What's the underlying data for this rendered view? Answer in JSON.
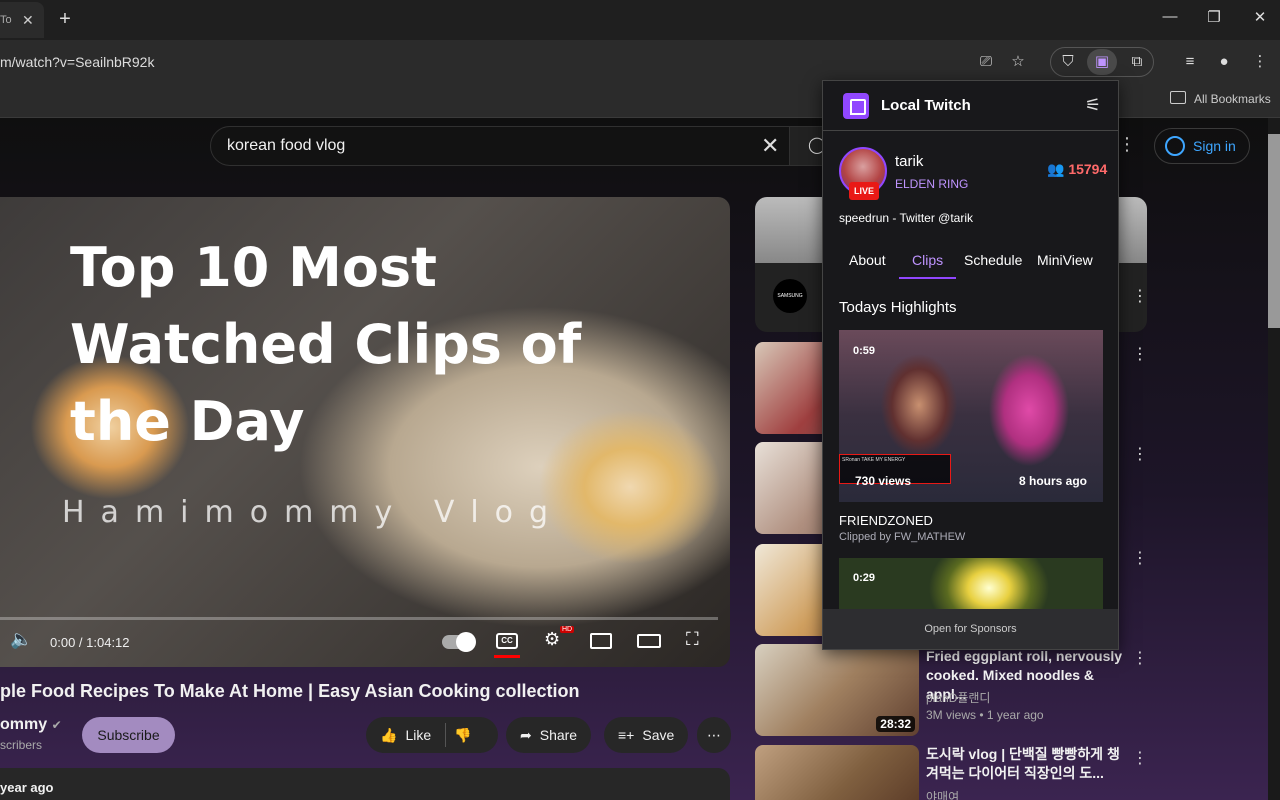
{
  "browser": {
    "tab_title": "To",
    "url": "m/watch?v=SeailnbR92k",
    "bookmarks_label": "All Bookmarks"
  },
  "youtube": {
    "search_value": "korean food vlog",
    "sign_in_label": "Sign in",
    "player": {
      "overlay_title": "Top 10 Most Watched Clips of the Day",
      "watermark": "Hamimommy Vlog",
      "time": "0:00 / 1:04:12",
      "cc_label": "CC",
      "hd_label": "HD"
    },
    "video_title": "ple Food Recipes To Make At Home | Easy Asian Cooking collection",
    "channel_name": "ommy",
    "subscribers": "scribers",
    "subscribe_label": "Subscribe",
    "like_label": "Like",
    "share_label": "Share",
    "save_label": "Save",
    "description_snippet": "year ago",
    "recommendations": [
      {
        "duration": "",
        "title": "",
        "channel": "",
        "meta": ""
      },
      {
        "duration": "",
        "title": "",
        "channel": "",
        "meta": ""
      },
      {
        "duration": "",
        "title": "",
        "channel": "",
        "meta": ""
      },
      {
        "duration": "28:32",
        "title": "Fried eggplant roll, nervously cooked. Mixed noodles & appl...",
        "channel": "planD플랜디",
        "meta": "3M views • 1 year ago"
      },
      {
        "duration": "",
        "title": "도시락 vlog | 단백질 빵빵하게 챙겨먹는 다이어터 직장인의 도...",
        "channel": "야매여",
        "meta": ""
      }
    ],
    "ad_brand": "SAMSUNG"
  },
  "popup": {
    "title": "Local Twitch",
    "streamer": {
      "name": "tarik",
      "game": "ELDEN RING",
      "live_label": "LIVE",
      "viewers": "15794",
      "description": "speedrun - Twitter @tarik"
    },
    "tabs": [
      {
        "label": "About"
      },
      {
        "label": "Clips"
      },
      {
        "label": "Schedule"
      },
      {
        "label": "MiniView"
      }
    ],
    "active_tab": "Clips",
    "section_title": "Todays Highlights",
    "clips": [
      {
        "duration": "0:59",
        "views": "730 views",
        "age": "8 hours ago",
        "title": "FRIENDZONED",
        "clipped_by": "Clipped by FW_MATHEW",
        "chat_text": "SRonan  TAKE MY ENERGY"
      },
      {
        "duration": "0:29",
        "views": "",
        "age": "",
        "title": "",
        "clipped_by": ""
      }
    ],
    "sponsors_label": "Open for Sponsors"
  },
  "colors": {
    "twitch_purple": "#9147ff",
    "live_red": "#e91916",
    "viewer_red": "#ff6a6a",
    "yt_link_blue": "#3ea6ff"
  }
}
